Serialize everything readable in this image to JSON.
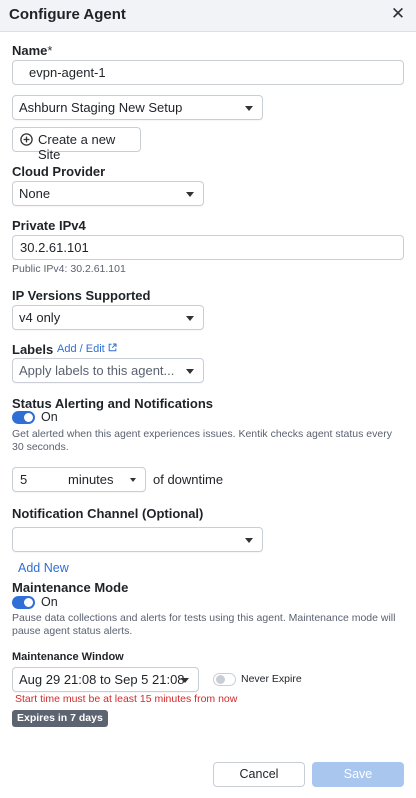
{
  "dialog": {
    "title": "Configure Agent",
    "close_label": "✕"
  },
  "name": {
    "label": "Name",
    "required_mark": "*",
    "value": "evpn-agent-1"
  },
  "site": {
    "selected": "Ashburn Staging New Setup",
    "create_label": "Create a new Site"
  },
  "cloud_provider": {
    "label": "Cloud Provider",
    "selected": "None"
  },
  "private_ipv4": {
    "label": "Private IPv4",
    "value": "30.2.61.101",
    "public_hint": "Public IPv4: 30.2.61.101"
  },
  "ip_versions": {
    "label": "IP Versions Supported",
    "selected": "v4 only"
  },
  "labels": {
    "label": "Labels",
    "edit_link": "Add / Edit",
    "placeholder": "Apply labels to this agent..."
  },
  "status_alerting": {
    "label": "Status Alerting and Notifications",
    "toggle_state": "On",
    "description": "Get alerted when this agent experiences issues. Kentik checks agent status every 30 seconds.",
    "duration_value": "5",
    "duration_unit": "minutes",
    "suffix": "of downtime"
  },
  "notification_channel": {
    "label": "Notification Channel (Optional)",
    "selected": "",
    "add_new": "Add New"
  },
  "maintenance_mode": {
    "label": "Maintenance Mode",
    "toggle_state": "On",
    "description": "Pause data collections and alerts for tests using this agent. Maintenance mode will pause agent status alerts."
  },
  "maintenance_window": {
    "label": "Maintenance Window",
    "range": "Aug 29 21:08 to Sep 5 21:08",
    "never_expire": "Never Expire",
    "error": "Start time must be at least 15 minutes from now",
    "badge": "Expires in 7 days"
  },
  "footer": {
    "cancel": "Cancel",
    "save": "Save"
  },
  "colors": {
    "accent": "#2f6fd6",
    "error": "#d42a2a",
    "save_disabled": "#a9c6ef",
    "badge": "#5b6470"
  }
}
